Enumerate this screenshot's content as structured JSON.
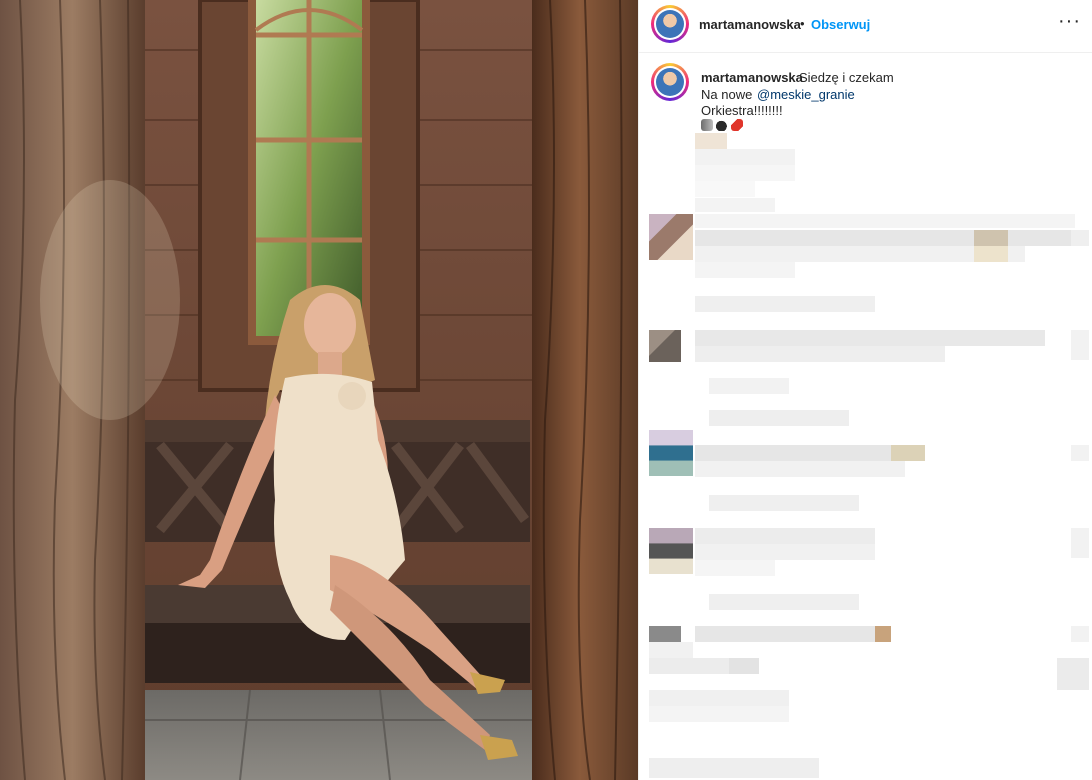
{
  "header": {
    "username": "martamanowska",
    "separator": "•",
    "follow_label": "Obserwuj",
    "more_icon": "ellipsis-icon",
    "more_label": "···"
  },
  "caption": {
    "username": "martamanowska",
    "line1": "Siedzę i czekam",
    "line2_prefix": "Na nowe",
    "mention": "@meskie_granie",
    "line3": "Orkiestra!!!!!!!!",
    "emojis": [
      "megaphone-emoji",
      "bomb-emoji",
      "firecracker-emoji"
    ]
  },
  "colors": {
    "follow": "#0095f6",
    "mention": "#00376b",
    "text": "#262626"
  }
}
